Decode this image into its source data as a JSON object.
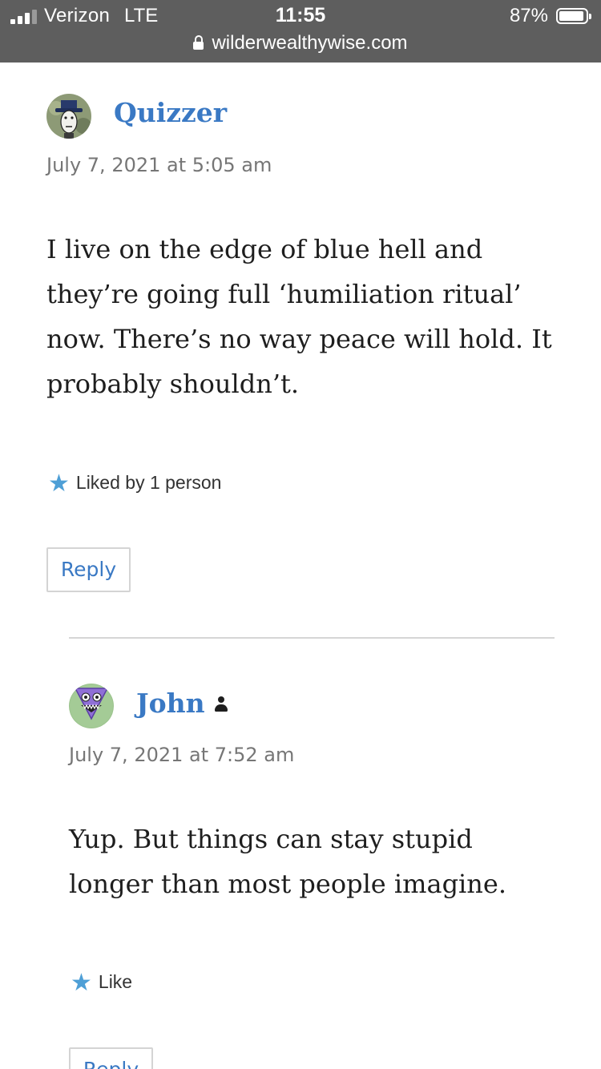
{
  "status_bar": {
    "carrier": "Verizon",
    "network": "LTE",
    "time": "11:55",
    "battery": "87%",
    "url": "wilderwealthywise.com"
  },
  "comments": [
    {
      "author": "Quizzer",
      "date": "July 7, 2021 at 5:05 am",
      "body": "I live on the edge of blue hell and they’re going full ‘humiliation ritual’ now. There’s no way peace will hold. It probably shouldn’t.",
      "likes": "Liked by 1 person",
      "reply": "Reply"
    },
    {
      "author": "John",
      "date": "July 7, 2021 at 7:52 am",
      "body": "Yup. But things can stay stupid longer than most people imagine.",
      "likes": "Like",
      "reply": "Reply"
    }
  ],
  "colors": {
    "link": "#3a79c4",
    "star": "#4e9fd6",
    "status_bar_bg": "#5e5e5e"
  },
  "icons": [
    "signal-icon",
    "lock-icon",
    "battery-icon",
    "star-icon",
    "author-badge-icon"
  ]
}
